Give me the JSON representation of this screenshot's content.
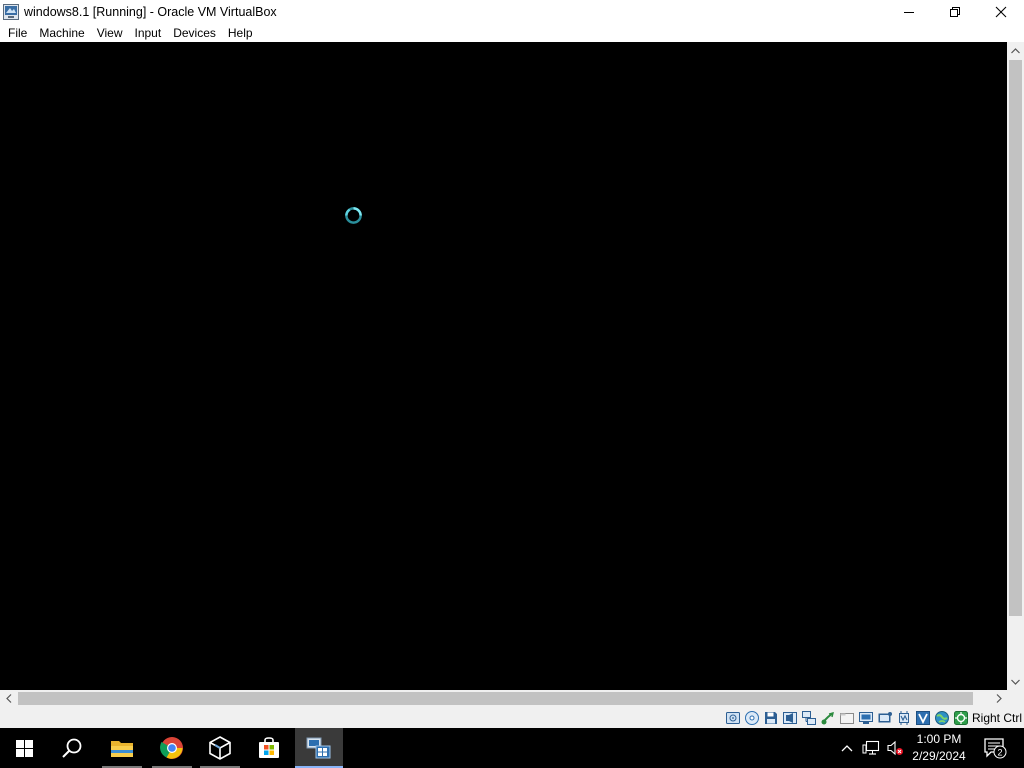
{
  "window": {
    "title": "windows8.1 [Running] - Oracle VM VirtualBox",
    "icon": "virtualbox-vm-icon",
    "controls": [
      "minimize-icon",
      "restore-icon",
      "close-icon"
    ]
  },
  "menu": {
    "items": [
      "File",
      "Machine",
      "View",
      "Input",
      "Devices",
      "Help"
    ]
  },
  "vm": {
    "state": "Running",
    "screen_background": "#000000",
    "spinner_icon": "loading-spinner-icon",
    "spinner_color": "#5fd3e0"
  },
  "statusbar": {
    "icons": [
      "hard-disk-icon",
      "optical-drive-icon",
      "floppy-icon",
      "audio-icon",
      "network-icon",
      "usb-icon",
      "shared-folders-icon",
      "display-icon",
      "recording-icon",
      "cpu-icon",
      "virtualization-icon",
      "globe-icon",
      "mouse-integration-icon"
    ],
    "host_key": "Right Ctrl"
  },
  "taskbar": {
    "start_icon": "windows-start-icon",
    "search_icon": "search-icon",
    "pinned": [
      "file-explorer-icon",
      "chrome-icon",
      "virtualbox-icon",
      "microsoft-store-icon",
      "windows8-vm-icon"
    ],
    "active_app": "windows8-vm-icon",
    "tray": {
      "chevron_icon": "chevron-up-icon",
      "network_icon": "network-tray-icon",
      "volume_icon": "volume-muted-icon",
      "time": "1:00 PM",
      "date": "2/29/2024",
      "notification_icon": "notification-icon",
      "notification_count": "2"
    }
  },
  "colors": {
    "titlebar": "#ffffff",
    "chrome": "#f0f0f0",
    "scroll_thumb": "#c2c2c2",
    "taskbar": "#000000"
  }
}
